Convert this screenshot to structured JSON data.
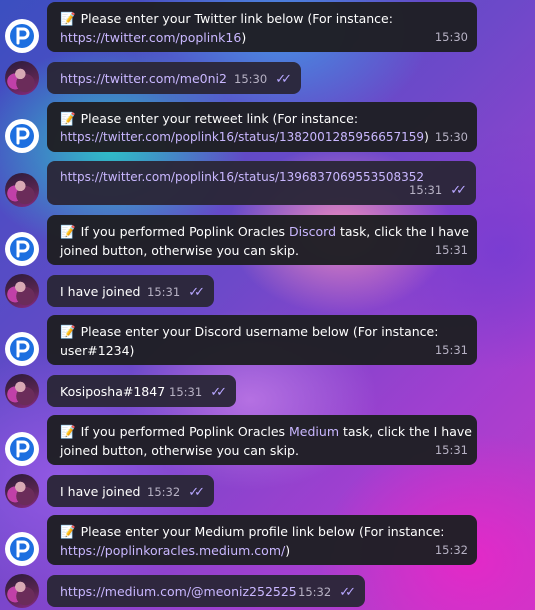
{
  "messages": [
    {
      "from": "bot",
      "emoji": "📝",
      "lines": [
        "Please enter your Twitter link below (For instance:"
      ],
      "link": "https://twitter.com/poplink16",
      "suffix": ")",
      "time": "15:30"
    },
    {
      "from": "user",
      "link": "https://twitter.com/me0ni2",
      "time": "15:30"
    },
    {
      "from": "bot",
      "emoji": "📝",
      "lines": [
        "Please enter your retweet link (For instance:"
      ],
      "link": "https://twitter.com/poplink16/status/1382001285956657159",
      "suffix": ")",
      "time": "15:30"
    },
    {
      "from": "user",
      "link": "https://twitter.com/poplink16/status/1396837069553508352",
      "time": "15:31"
    },
    {
      "from": "bot",
      "emoji": "📝",
      "pre": "If you performed Poplink Oracles ",
      "word": "Discord",
      "post": " task, click the I have",
      "line2": "joined button, otherwise you can skip.",
      "time": "15:31"
    },
    {
      "from": "user",
      "text": "I have joined",
      "time": "15:31"
    },
    {
      "from": "bot",
      "emoji": "📝",
      "lines": [
        "Please enter your Discord username below (For instance:"
      ],
      "plain2": "user#1234)",
      "time": "15:31"
    },
    {
      "from": "user",
      "text": "Kosiposha#1847",
      "time": "15:31"
    },
    {
      "from": "bot",
      "emoji": "📝",
      "pre": "If you performed Poplink Oracles ",
      "word": "Medium",
      "post": " task, click the I have",
      "line2": "joined button, otherwise you can skip.",
      "time": "15:31"
    },
    {
      "from": "user",
      "text": "I have joined",
      "time": "15:32"
    },
    {
      "from": "bot",
      "emoji": "📝",
      "lines": [
        "Please enter your Medium profile link below (For instance:"
      ],
      "link": "https://poplinkoracles.medium.com/",
      "suffix": ")",
      "time": "15:32"
    },
    {
      "from": "user",
      "link": "https://medium.com/@meoniz252525",
      "time": "15:32"
    }
  ],
  "icons": {
    "bot_avatar": "poplink-logo-icon",
    "user_avatar": "user-avatar",
    "read_receipt": "double-check-icon"
  },
  "colors": {
    "bubble": "#1f1f24",
    "link": "#c9b7ff",
    "check": "#b7a6ff",
    "time": "#b7b2c4"
  }
}
